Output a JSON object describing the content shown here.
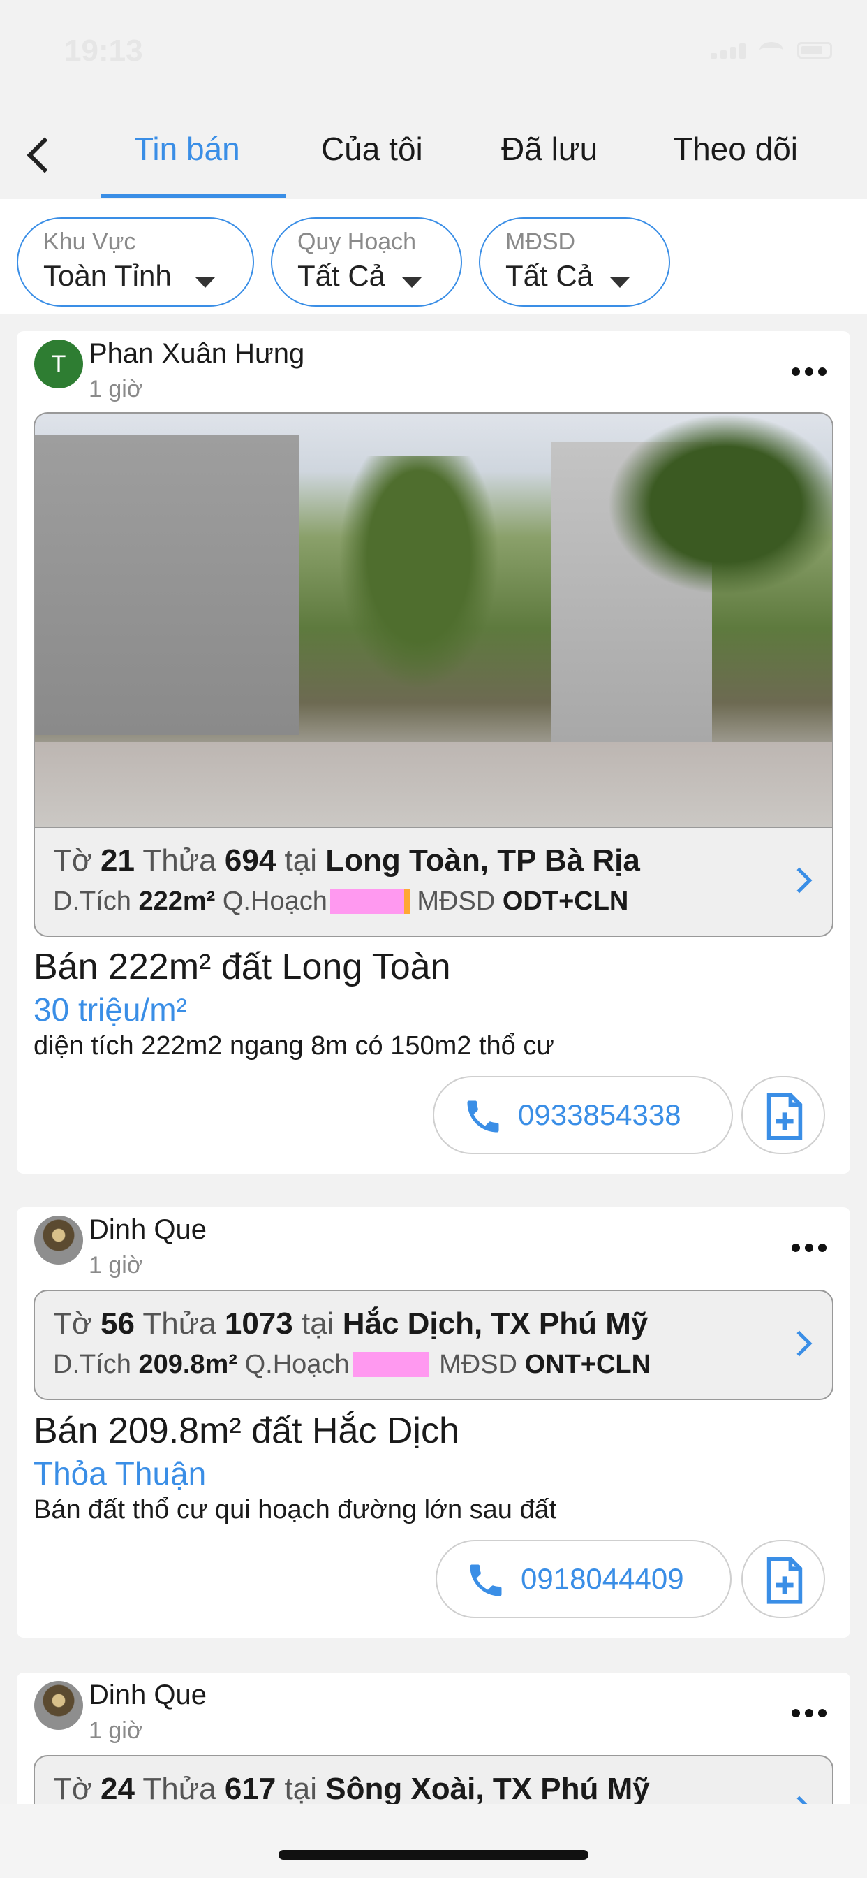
{
  "status_bar": {
    "time": "19:13"
  },
  "nav": {
    "tabs": [
      {
        "label": "Tin bán",
        "active": true
      },
      {
        "label": "Của tôi",
        "active": false
      },
      {
        "label": "Đã lưu",
        "active": false
      },
      {
        "label": "Theo dõi",
        "active": false
      }
    ]
  },
  "filters": [
    {
      "label": "Khu Vực",
      "value": "Toàn Tỉnh"
    },
    {
      "label": "Quy Hoạch",
      "value": "Tất Cả"
    },
    {
      "label": "MĐSD",
      "value": "Tất Cả"
    }
  ],
  "colors": {
    "accent": "#3a8ee6",
    "planning_swatch": "#ff99f0",
    "swatch_edge": "#ffa733",
    "avatar_green": "#2e7d32"
  },
  "posts": [
    {
      "avatar_letter": "T",
      "author": "Phan Xuân Hưng",
      "time": "1 giờ",
      "has_photo": true,
      "parcel": {
        "to_label": "Tờ",
        "to": "21",
        "thua_label": "Thửa",
        "thua": "694",
        "tai_label": "tại",
        "location": "Long Toàn, TP Bà Rịa"
      },
      "details": {
        "dt_label": "D.Tích",
        "dt": "222m²",
        "qh_label": "Q.Hoạch",
        "mdsd_label": "MĐSD",
        "mdsd": "ODT+CLN"
      },
      "title": "Bán 222m² đất Long Toàn",
      "price": "30 triệu/m²",
      "description": "diện tích 222m2 ngang 8m có 150m2 thổ cư",
      "phone": "0933854338"
    },
    {
      "author": "Dinh Que",
      "time": "1 giờ",
      "has_photo": false,
      "parcel": {
        "to_label": "Tờ",
        "to": "56",
        "thua_label": "Thửa",
        "thua": "1073",
        "tai_label": "tại",
        "location": "Hắc Dịch, TX Phú Mỹ"
      },
      "details": {
        "dt_label": "D.Tích",
        "dt": "209.8m²",
        "qh_label": "Q.Hoạch",
        "mdsd_label": "MĐSD",
        "mdsd": "ONT+CLN"
      },
      "title": "Bán 209.8m² đất Hắc Dịch",
      "price": "Thỏa Thuận",
      "description": "Bán đất thổ cư qui hoạch đường lớn sau đất",
      "phone": "0918044409"
    },
    {
      "author": "Dinh Que",
      "time": "1 giờ",
      "has_photo": false,
      "parcel": {
        "to_label": "Tờ",
        "to": "24",
        "thua_label": "Thửa",
        "thua": "617",
        "tai_label": "tại",
        "location": "Sông Xoài, TX Phú Mỹ"
      }
    }
  ]
}
